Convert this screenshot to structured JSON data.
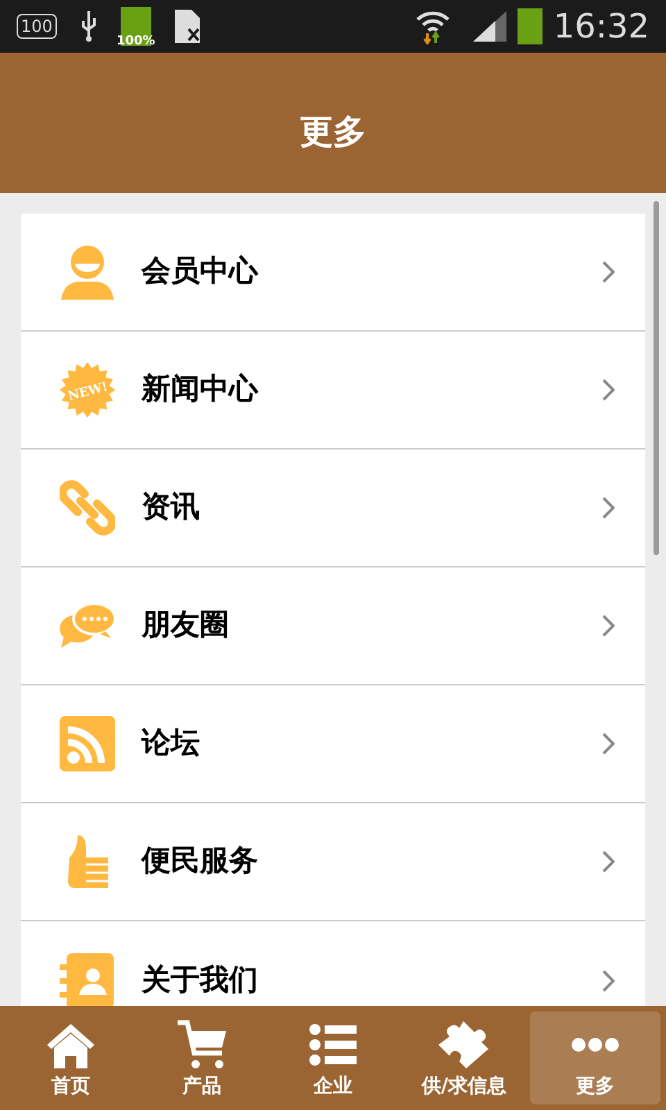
{
  "status_bar": {
    "sd_label": "100",
    "battery_label": "100%",
    "time": "16:32"
  },
  "header": {
    "title": "更多"
  },
  "menu": [
    {
      "kind": "member",
      "label": "会员中心"
    },
    {
      "kind": "news",
      "label": "新闻中心",
      "icon_text": "NEW!"
    },
    {
      "kind": "link",
      "label": "资讯"
    },
    {
      "kind": "chat",
      "label": "朋友圈"
    },
    {
      "kind": "rss",
      "label": "论坛"
    },
    {
      "kind": "thumb",
      "label": "便民服务"
    },
    {
      "kind": "contact",
      "label": "关于我们"
    }
  ],
  "tab_bar": [
    {
      "kind": "home",
      "label": "首页",
      "selected": false
    },
    {
      "kind": "cart",
      "label": "产品",
      "selected": false
    },
    {
      "kind": "list",
      "label": "企业",
      "selected": false
    },
    {
      "kind": "puzzle",
      "label": "供/求信息",
      "selected": false
    },
    {
      "kind": "more",
      "label": "更多",
      "selected": true
    }
  ]
}
